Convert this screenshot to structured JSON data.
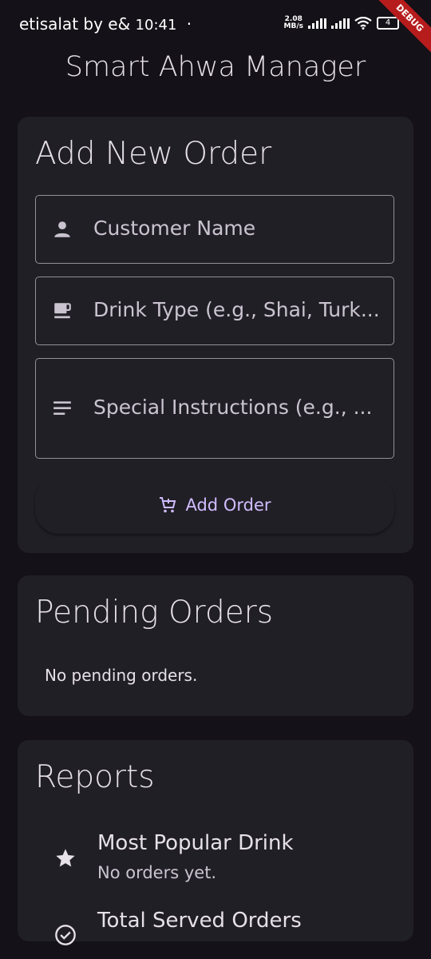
{
  "status_bar": {
    "carrier": "etisalat by e&",
    "time": "10:41",
    "dot": "·",
    "net_speed_value": "2.08",
    "net_speed_unit": "MB/s",
    "battery_level": "4",
    "debug_label": "DEBUG"
  },
  "app_bar": {
    "title": "Smart Ahwa Manager"
  },
  "add_order": {
    "title": "Add New Order",
    "customer_placeholder": "Customer Name",
    "customer_icon": "person-icon",
    "drink_placeholder": "Drink Type (e.g., Shai, Turk...",
    "drink_icon": "coffee-cup-icon",
    "instructions_placeholder": "Special Instructions (e.g., ...",
    "instructions_icon": "notes-icon",
    "button_label": "Add Order",
    "button_icon": "add-shopping-cart-icon"
  },
  "pending_orders": {
    "title": "Pending Orders",
    "empty_message": "No pending orders."
  },
  "reports": {
    "title": "Reports",
    "items": [
      {
        "icon": "star-icon",
        "title": "Most Popular Drink",
        "subtitle": "No orders yet."
      },
      {
        "icon": "check-circle-icon",
        "title": "Total Served Orders",
        "subtitle": ""
      }
    ]
  },
  "colors": {
    "background": "#141218",
    "card": "#211f26",
    "accent": "#d0bcff",
    "outline": "#938f99",
    "debug_ribbon": "#b71c1c"
  }
}
